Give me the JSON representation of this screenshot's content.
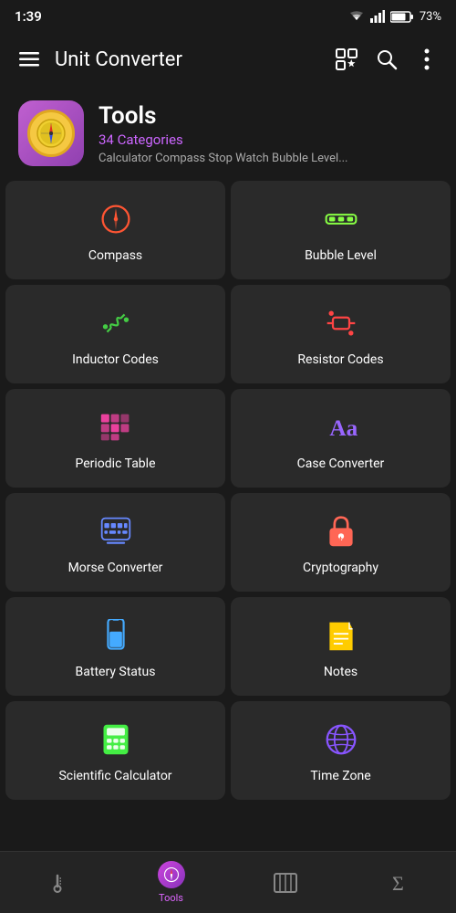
{
  "statusBar": {
    "time": "1:39",
    "batteryLevel": "73%"
  },
  "appBar": {
    "title": "Unit Converter",
    "menuIcon": "≡",
    "gridStarIcon": "⊞",
    "searchIcon": "🔍",
    "moreIcon": "⋮"
  },
  "header": {
    "title": "Tools",
    "subtitle": "34 Categories",
    "description": "Calculator Compass Stop Watch Bubble Level..."
  },
  "grid": {
    "items": [
      {
        "id": "compass",
        "label": "Compass",
        "iconColor": "#ff5533",
        "iconType": "compass"
      },
      {
        "id": "bubble-level",
        "label": "Bubble Level",
        "iconColor": "#88ff44",
        "iconType": "bubble"
      },
      {
        "id": "inductor-codes",
        "label": "Inductor Codes",
        "iconColor": "#44cc44",
        "iconType": "inductor"
      },
      {
        "id": "resistor-codes",
        "label": "Resistor Codes",
        "iconColor": "#ff4444",
        "iconType": "resistor"
      },
      {
        "id": "periodic-table",
        "label": "Periodic Table",
        "iconColor": "#ff44aa",
        "iconType": "periodic"
      },
      {
        "id": "case-converter",
        "label": "Case Converter",
        "iconColor": "#9966ff",
        "iconType": "text"
      },
      {
        "id": "morse-converter",
        "label": "Morse Converter",
        "iconColor": "#6688ff",
        "iconType": "morse"
      },
      {
        "id": "cryptography",
        "label": "Cryptography",
        "iconColor": "#ff6655",
        "iconType": "lock"
      },
      {
        "id": "battery-status",
        "label": "Battery Status",
        "iconColor": "#44aaff",
        "iconType": "battery"
      },
      {
        "id": "notes",
        "label": "Notes",
        "iconColor": "#ffcc00",
        "iconType": "notes"
      },
      {
        "id": "scientific-calculator",
        "label": "Scientific Calculator",
        "iconColor": "#44ee44",
        "iconType": "calculator"
      },
      {
        "id": "time-zone",
        "label": "Time Zone",
        "iconColor": "#8855ff",
        "iconType": "globe"
      }
    ]
  },
  "bottomNav": {
    "items": [
      {
        "id": "temperature",
        "label": "",
        "iconType": "temp",
        "active": false
      },
      {
        "id": "tools",
        "label": "Tools",
        "iconType": "compass-nav",
        "active": true
      },
      {
        "id": "library",
        "label": "",
        "iconType": "library",
        "active": false
      },
      {
        "id": "sum",
        "label": "",
        "iconType": "sigma",
        "active": false
      }
    ]
  }
}
